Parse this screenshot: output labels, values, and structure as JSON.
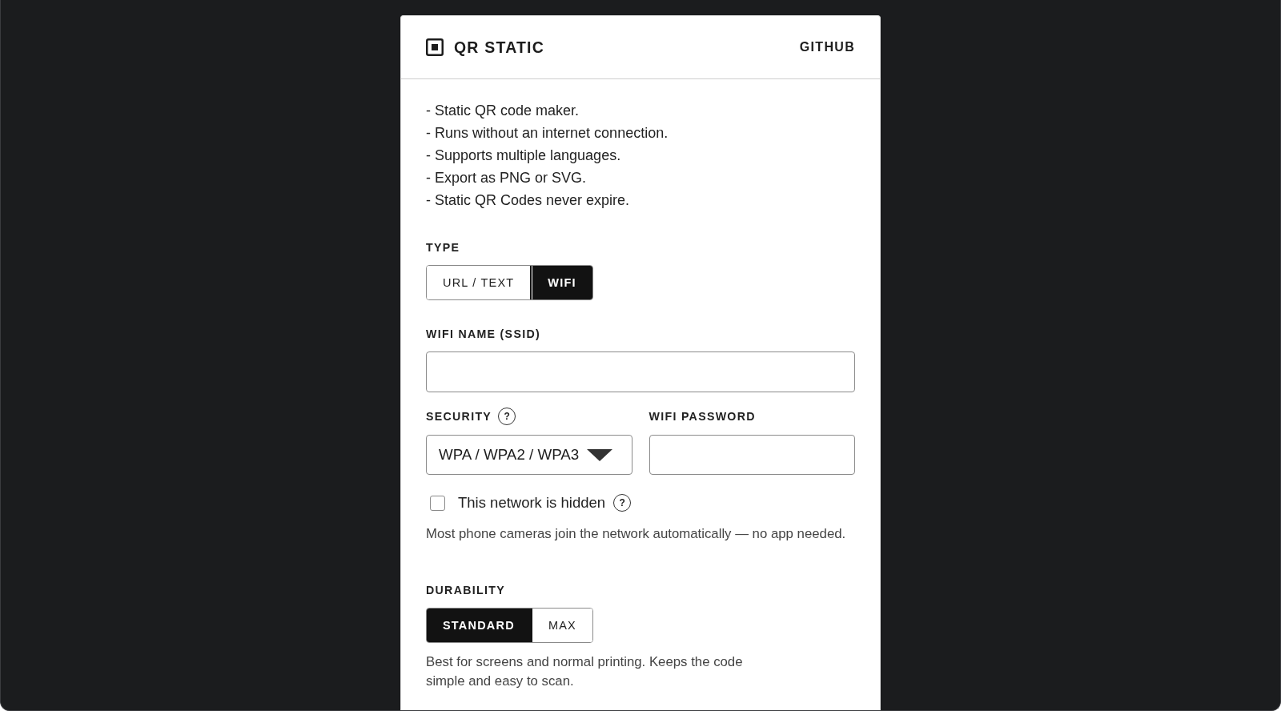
{
  "header": {
    "title": "QR STATIC",
    "link": "GITHUB"
  },
  "features": [
    "- Static QR code maker.",
    "- Runs without an internet connection.",
    "- Supports multiple languages.",
    "- Export as PNG or SVG.",
    "- Static QR Codes never expire."
  ],
  "type": {
    "label": "TYPE",
    "options": [
      {
        "label": "URL / TEXT",
        "selected": false
      },
      {
        "label": "WIFI",
        "selected": true
      }
    ]
  },
  "ssid": {
    "label": "WIFI NAME (SSID)"
  },
  "security": {
    "label": "SECURITY",
    "help": "?",
    "value": "WPA / WPA2 / WPA3"
  },
  "password": {
    "label": "WIFI PASSWORD"
  },
  "hidden": {
    "label": "This network is hidden",
    "checked": false,
    "help": "?"
  },
  "hint": "Most phone cameras join the network automatically — no app needed.",
  "durability": {
    "label": "DURABILITY",
    "options": [
      {
        "label": "STANDARD",
        "selected": true
      },
      {
        "label": "MAX",
        "selected": false
      }
    ],
    "description": "Best for screens and normal printing. Keeps the code simple and easy to scan."
  }
}
